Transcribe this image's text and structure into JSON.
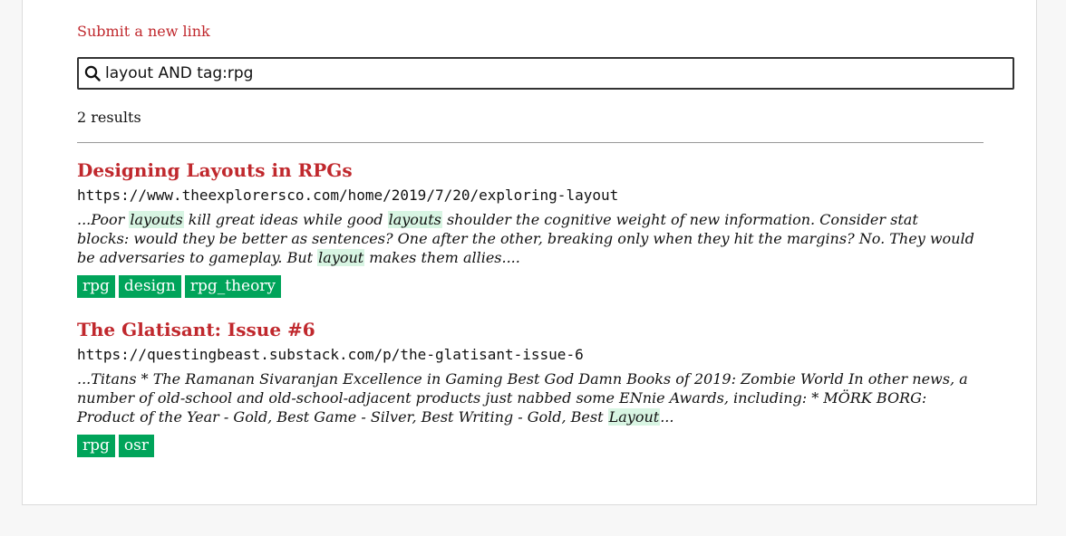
{
  "submit_link_label": "Submit a new link",
  "search": {
    "icon": "search-icon",
    "value": "layout AND tag:rpg"
  },
  "result_count": "2 results",
  "colors": {
    "link": "#c0282d",
    "tag_bg": "#00a45a",
    "highlight": "#d8f5e3"
  },
  "results": [
    {
      "title": "Designing Layouts in RPGs",
      "url": "https://www.theexplorersco.com/home/2019/7/20/exploring-layout",
      "snippet": [
        {
          "text": "...Poor ",
          "hl": false
        },
        {
          "text": "layouts",
          "hl": true
        },
        {
          "text": " kill great ideas while good ",
          "hl": false
        },
        {
          "text": "layouts",
          "hl": true
        },
        {
          "text": " shoulder the cognitive weight of new information. Consider stat blocks: would they be better as sentences? One after the other, breaking only when they hit the margins? No. They would be adversaries to gameplay. But ",
          "hl": false
        },
        {
          "text": "layout",
          "hl": true
        },
        {
          "text": " makes them allies....",
          "hl": false
        }
      ],
      "tags": [
        "rpg",
        "design",
        "rpg_theory"
      ]
    },
    {
      "title": "The Glatisant: Issue #6",
      "url": "https://questingbeast.substack.com/p/the-glatisant-issue-6",
      "snippet": [
        {
          "text": "...Titans * The Ramanan Sivaranjan Excellence in Gaming Best God Damn Books of 2019: Zombie World In other news, a number of old-school and old-school-adjacent products just nabbed some ENnie Awards, including: * MÖRK BORG: Product of the Year - Gold, Best Game - Silver, Best Writing - Gold, Best ",
          "hl": false
        },
        {
          "text": "Layout",
          "hl": true
        },
        {
          "text": "...",
          "hl": false
        }
      ],
      "tags": [
        "rpg",
        "osr"
      ]
    }
  ]
}
